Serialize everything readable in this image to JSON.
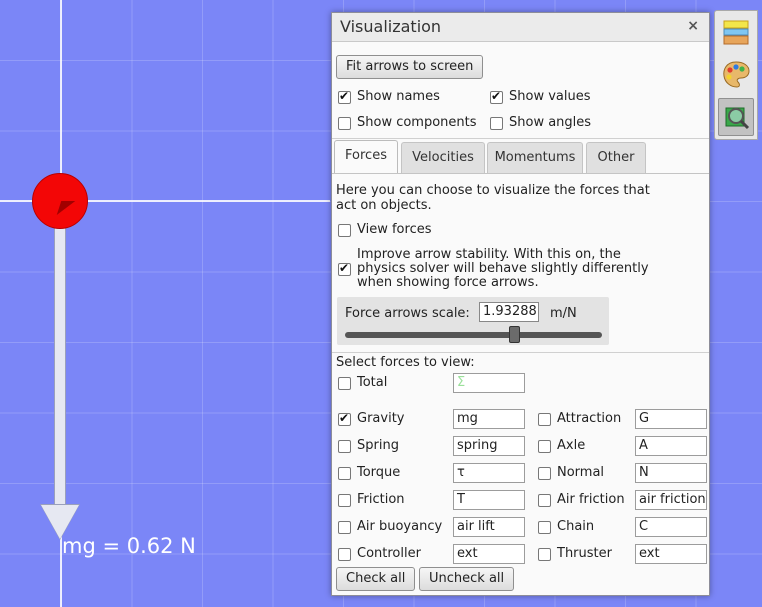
{
  "scene": {
    "force_label": "mg = 0.62 N"
  },
  "panel": {
    "title": "Visualization",
    "close_glyph": "×",
    "fit_button": "Fit arrows to screen",
    "options": [
      {
        "label": "Show names",
        "checked": true
      },
      {
        "label": "Show values",
        "checked": true
      },
      {
        "label": "Show components",
        "checked": false
      },
      {
        "label": "Show angles",
        "checked": false
      }
    ],
    "tabs": [
      {
        "label": "Forces",
        "active": true
      },
      {
        "label": "Velocities",
        "active": false
      },
      {
        "label": "Momentums",
        "active": false
      },
      {
        "label": "Other",
        "active": false
      }
    ],
    "description": "Here you can choose to visualize the forces that act on objects.",
    "view_forces": {
      "label": "View forces",
      "checked": false
    },
    "stability": {
      "label": "Improve arrow stability. With this on, the physics solver will behave slightly differently when showing force arrows.",
      "checked": true
    },
    "scale": {
      "label": "Force arrows scale:",
      "value": "1.93288",
      "unit": "m/N",
      "slider_fraction": 0.66
    },
    "select_label": "Select forces to view:",
    "total": {
      "label": "Total",
      "symbol": "Σ",
      "checked": false
    },
    "forces_left": [
      {
        "label": "Gravity",
        "symbol": "mg",
        "checked": true
      },
      {
        "label": "Spring",
        "symbol": "spring",
        "checked": false
      },
      {
        "label": "Torque",
        "symbol": "τ",
        "checked": false
      },
      {
        "label": "Friction",
        "symbol": "T",
        "checked": false
      },
      {
        "label": "Air buoyancy",
        "symbol": "air lift",
        "checked": false
      },
      {
        "label": "Controller",
        "symbol": "ext",
        "checked": false
      }
    ],
    "forces_right": [
      {
        "label": "Attraction",
        "symbol": "G",
        "checked": false
      },
      {
        "label": "Axle",
        "symbol": "A",
        "checked": false
      },
      {
        "label": "Normal",
        "symbol": "N",
        "checked": false
      },
      {
        "label": "Air friction",
        "symbol": "air friction",
        "checked": false
      },
      {
        "label": "Chain",
        "symbol": "C",
        "checked": false
      },
      {
        "label": "Thruster",
        "symbol": "ext",
        "checked": false
      }
    ],
    "check_all": "Check all",
    "uncheck_all": "Uncheck all"
  },
  "sidebar": [
    {
      "icon": "layers-icon",
      "active": false
    },
    {
      "icon": "palette-icon",
      "active": false
    },
    {
      "icon": "magnifier-icon",
      "active": true
    }
  ],
  "colors": {
    "background": "#7b86f7",
    "ball": "#f30606",
    "arrow": "#e6e8f2"
  }
}
